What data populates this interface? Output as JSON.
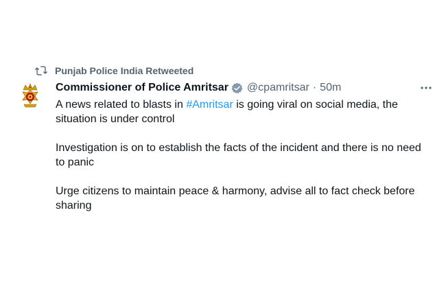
{
  "retweet": {
    "label": "Punjab Police India Retweeted",
    "icon": "retweet-icon"
  },
  "author": {
    "display_name": "Commissioner of Police Amritsar",
    "verified_icon": "verified-badge-icon",
    "handle": "@cpamritsar",
    "separator": "·",
    "time": "50m",
    "avatar_icon": "police-emblem-avatar"
  },
  "more_menu_icon": "more-dots-icon",
  "tweet": {
    "p1_a": "A news related to blasts in ",
    "p1_hashtag": "#Amritsar",
    "p1_b": " is going viral on social media, the situation is under control",
    "p2": "Investigation is on to establish the facts of the incident and there is no need  to panic",
    "p3": "Urge citizens to maintain peace & harmony, advise all to fact check before sharing"
  },
  "colors": {
    "text": "#0f1419",
    "secondary": "#536471",
    "link": "#1d9bf0",
    "verified": "#829aab"
  }
}
